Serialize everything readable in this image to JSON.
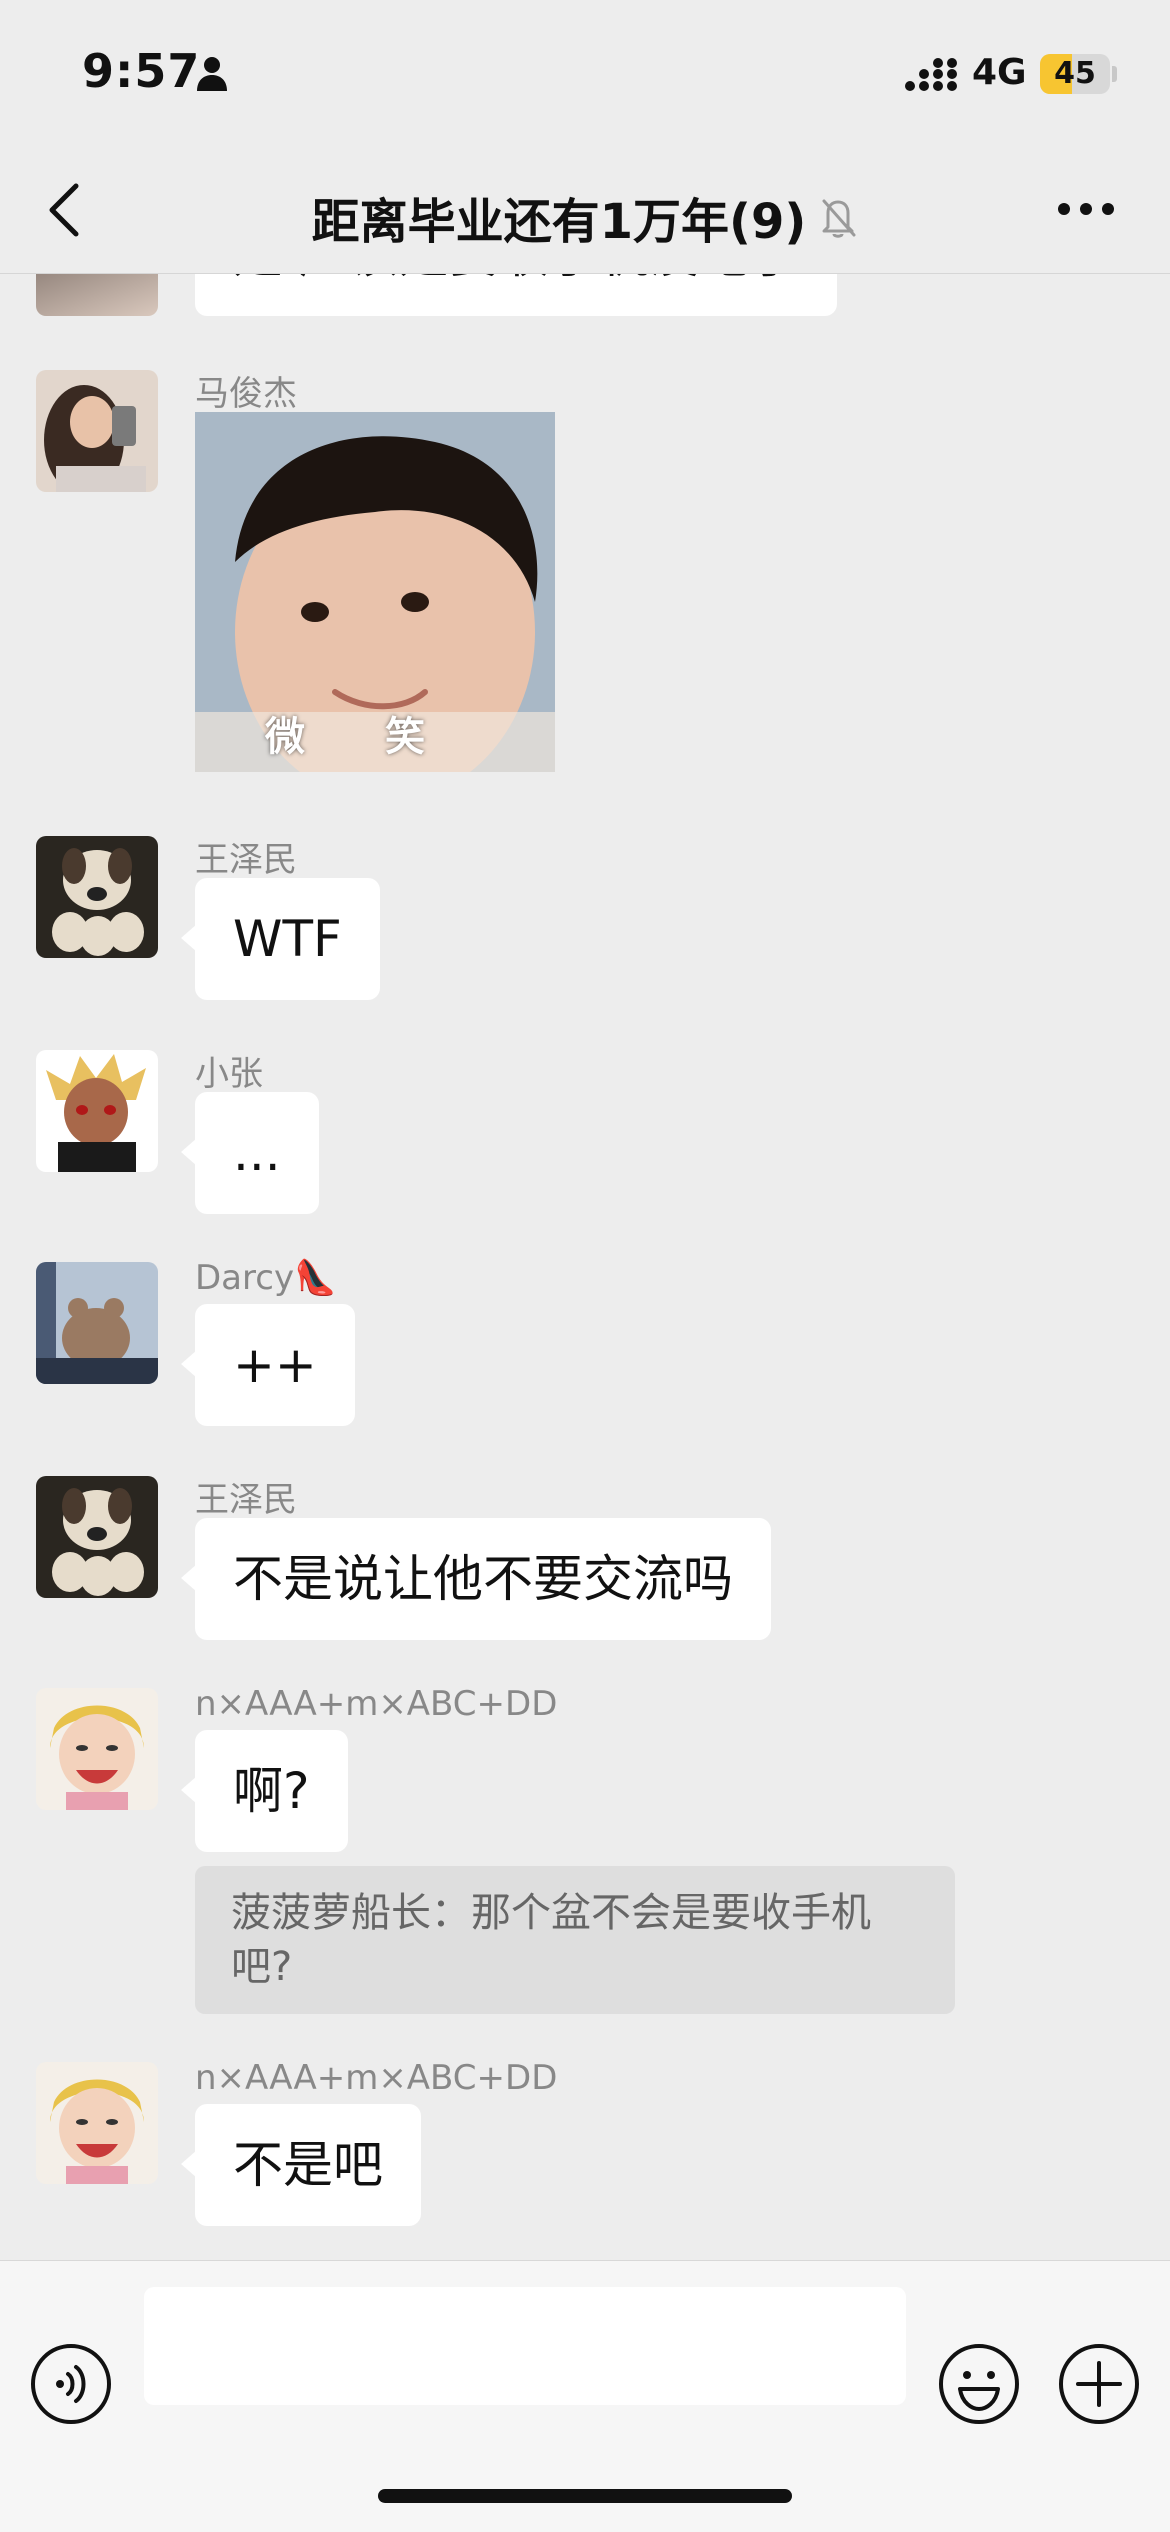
{
  "status_bar": {
    "time": "9:57",
    "network": "4G",
    "battery": "45",
    "battery_level": 0.45,
    "battery_color": "#f7c531"
  },
  "nav": {
    "back_icon": "chevron-left-icon",
    "title": "距离毕业还有1万年(9)",
    "mute_icon": "bell-slash-icon",
    "more_icon": "ellipsis-icon"
  },
  "messages": [
    {
      "type": "text",
      "text": "是 应该是要收手机没跑了"
    },
    {
      "type": "sticker",
      "sender": "马俊杰",
      "caption_left": "微",
      "caption_right": "笑"
    },
    {
      "type": "text",
      "sender": "王泽民",
      "text": "WTF"
    },
    {
      "type": "text",
      "sender": "小张",
      "text": "..."
    },
    {
      "type": "text",
      "sender": "Darcy👠",
      "text": "++"
    },
    {
      "type": "text",
      "sender": "王泽民",
      "text": "不是说让他不要交流吗"
    },
    {
      "type": "text",
      "sender": "n×AAA+m×ABC+DD",
      "text": "啊?",
      "quote": "菠菠萝船长：那个盆不会是要收手机吧?"
    },
    {
      "type": "text",
      "sender": "n×AAA+m×ABC+DD",
      "text": "不是吧"
    }
  ],
  "input_bar": {
    "voice_icon": "voice-icon",
    "emoji_icon": "emoji-icon",
    "plus_icon": "plus-icon",
    "placeholder": ""
  },
  "colors": {
    "background": "#ededed",
    "bubble": "#ffffff",
    "quote": "#dedede",
    "sender": "#888888"
  }
}
